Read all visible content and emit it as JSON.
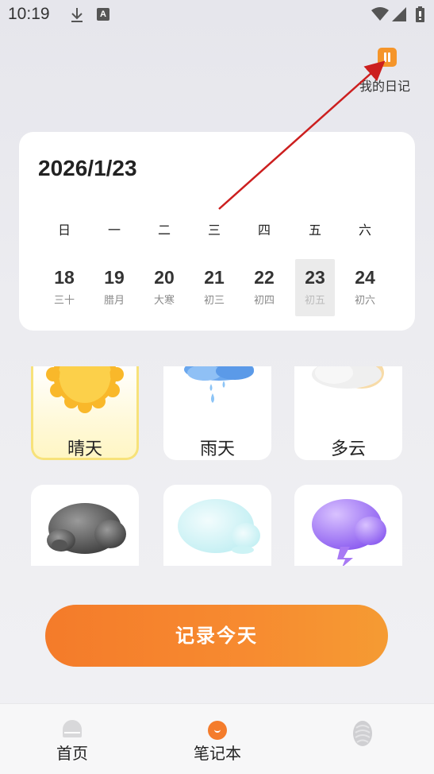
{
  "status_bar": {
    "time": "10:19",
    "icons": [
      "download-icon",
      "a-notification-icon",
      "wifi-icon",
      "signal-icon",
      "battery-icon"
    ]
  },
  "diary": {
    "label": "我的日记",
    "icon": "diary-icon",
    "icon_color": "#f5952a"
  },
  "calendar": {
    "date": "2026/1/23",
    "weekdays": [
      "日",
      "一",
      "二",
      "三",
      "四",
      "五",
      "六"
    ],
    "days": [
      {
        "num": "18",
        "lunar": "三十"
      },
      {
        "num": "19",
        "lunar": "腊月"
      },
      {
        "num": "20",
        "lunar": "大寒"
      },
      {
        "num": "21",
        "lunar": "初三"
      },
      {
        "num": "22",
        "lunar": "初四"
      },
      {
        "num": "23",
        "lunar": "初五",
        "selected": true
      },
      {
        "num": "24",
        "lunar": "初六"
      }
    ]
  },
  "weather": {
    "top_row": [
      {
        "label": "晴天",
        "icon": "sun-icon",
        "selected": true
      },
      {
        "label": "雨天",
        "icon": "rain-cloud-icon"
      },
      {
        "label": "多云",
        "icon": "cloudy-icon"
      }
    ],
    "bottom_row": [
      {
        "icon": "dark-cloud-icon"
      },
      {
        "icon": "fog-cloud-icon"
      },
      {
        "icon": "thunder-cloud-icon"
      }
    ]
  },
  "record_button": {
    "label": "记录今天",
    "color": "#f47b2a"
  },
  "bottom_nav": {
    "items": [
      {
        "label": "首页",
        "icon": "home-icon"
      },
      {
        "label": "笔记本",
        "icon": "notebook-icon",
        "active": true
      },
      {
        "label": "",
        "icon": "profile-icon"
      }
    ]
  },
  "annotation": {
    "arrow_color": "#cc1f1f"
  }
}
